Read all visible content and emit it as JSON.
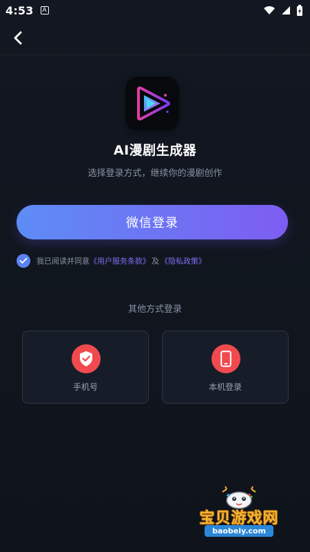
{
  "status_bar": {
    "time": "4:53",
    "a_badge": "A"
  },
  "app": {
    "title": "AI漫剧生成器",
    "subtitle": "选择登录方式，继续你的漫剧创作"
  },
  "login": {
    "wechat_label": "微信登录",
    "agreement_prefix": "我已阅读并同意",
    "agreement_terms": "《用户服务条款》",
    "agreement_and": "及",
    "agreement_privacy": "《隐私政策》",
    "agreement_checked": true
  },
  "other_login": {
    "title": "其他方式登录",
    "options": [
      {
        "label": "手机号",
        "icon": "shield-check-icon"
      },
      {
        "label": "本机登录",
        "icon": "phone-device-icon"
      }
    ]
  },
  "watermark": {
    "title": "宝贝游戏网",
    "url": "baobeiy.com"
  },
  "colors": {
    "background": "#10141c",
    "button_gradient_start": "#5d8df5",
    "button_gradient_end": "#7d5df2",
    "accent_link": "#7f6cf0",
    "option_icon_bg": "#f04a4f"
  }
}
